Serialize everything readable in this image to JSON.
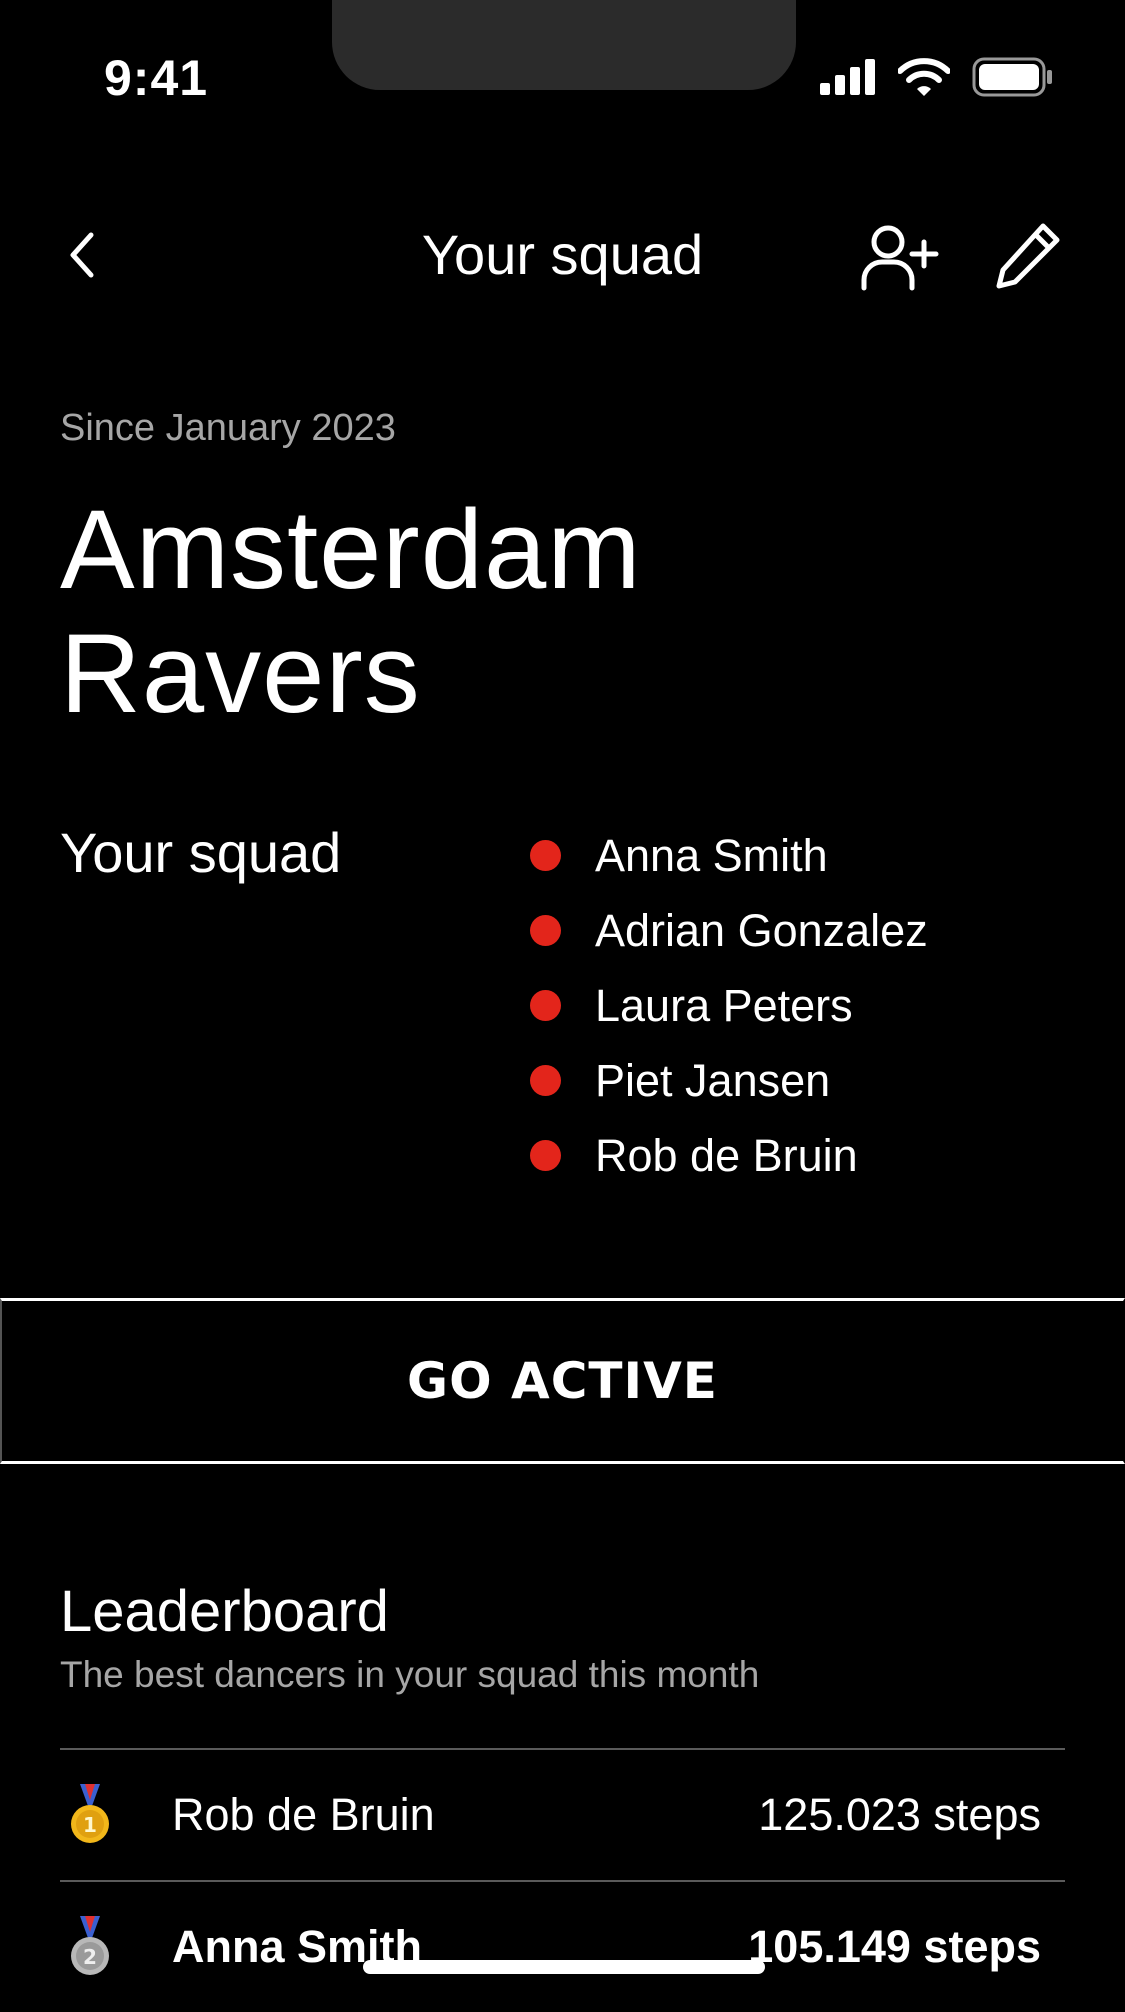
{
  "status_bar": {
    "time": "9:41"
  },
  "nav": {
    "title": "Your squad"
  },
  "squad": {
    "since": "Since January 2023",
    "name": "Amsterdam Ravers",
    "members_label": "Your squad",
    "members": [
      "Anna Smith",
      "Adrian Gonzalez",
      "Laura Peters",
      "Piet Jansen",
      "Rob de Bruin"
    ],
    "member_dot_color": "#e3251b"
  },
  "cta": {
    "label": "GO ACTIVE"
  },
  "leaderboard": {
    "title": "Leaderboard",
    "subtitle": "The best dancers in your squad this month",
    "rows": [
      {
        "rank": "1",
        "medal": "gold-medal-icon",
        "name": "Rob de  Bruin",
        "steps": "125.023 steps"
      },
      {
        "rank": "2",
        "medal": "silver-medal-icon",
        "name": "Anna Smith",
        "steps": "105.149 steps"
      }
    ]
  }
}
